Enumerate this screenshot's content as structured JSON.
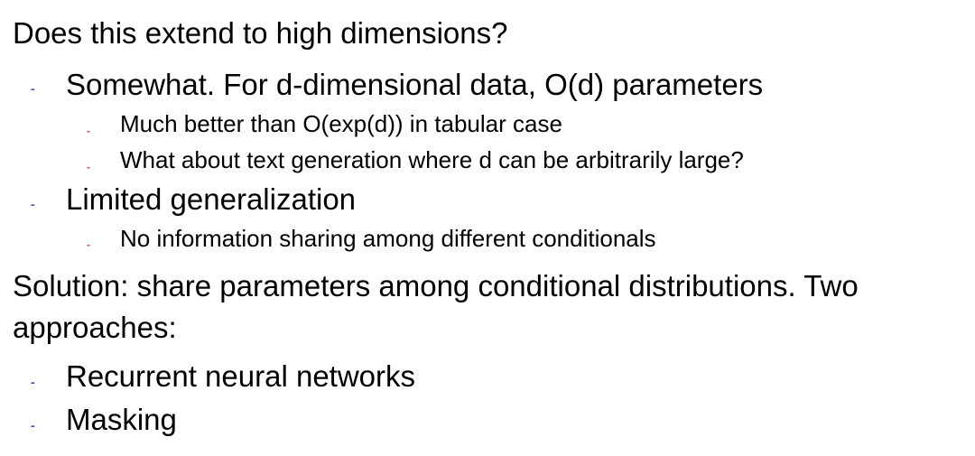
{
  "slide": {
    "heading1": "Does this extend to high dimensions?",
    "points": [
      {
        "text": "Somewhat. For d-dimensional data, O(d) parameters",
        "subpoints": [
          "Much better than O(exp(d)) in tabular case",
          "What about text generation where d can be arbitrarily large?"
        ]
      },
      {
        "text": "Limited generalization",
        "subpoints": [
          "No information sharing among different conditionals"
        ]
      }
    ],
    "heading2_line1": "Solution: share parameters among conditional distributions. Two",
    "heading2_line2": "approaches:",
    "approaches": [
      "Recurrent neural networks",
      "Masking"
    ],
    "bullet_level1": "-",
    "bullet_level2": "-",
    "colors": {
      "bullet_level1": "#3a55b5",
      "bullet_level2": "#c0504d",
      "text": "#000000"
    }
  }
}
